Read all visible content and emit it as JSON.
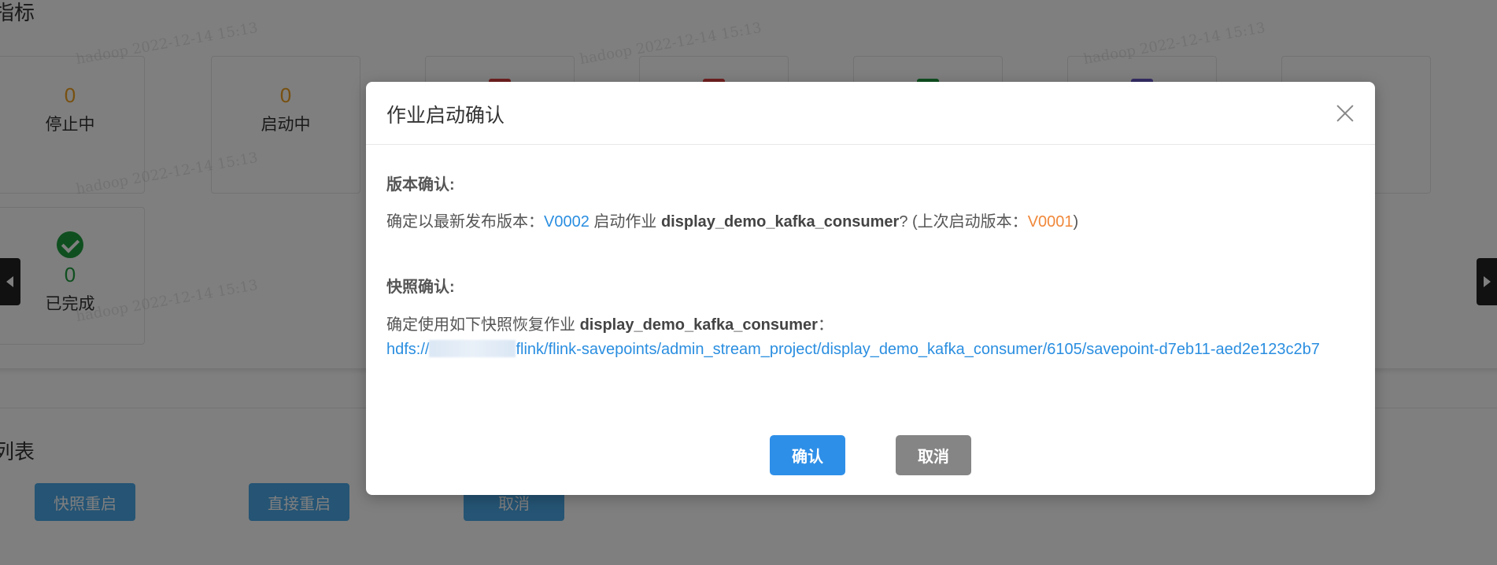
{
  "background": {
    "metrics_title": "指标",
    "list_title": "列表",
    "watermark_text": "hadoop  2022-12-14  15:13",
    "stat_cards": [
      {
        "value": "0",
        "label": "停止中",
        "color": "#f0a020"
      },
      {
        "value": "0",
        "label": "启动中",
        "color": "#f0a020"
      },
      {
        "value": "0",
        "label": "已完成",
        "color": "#1e9e3e"
      }
    ],
    "buttons": [
      {
        "label": "快照重启"
      },
      {
        "label": "直接重启"
      },
      {
        "label": "取消"
      }
    ]
  },
  "dialog": {
    "title": "作业启动确认",
    "version_section": {
      "heading": "版本确认:",
      "prefix": "确定以最新发布版本：",
      "new_version": "V0002",
      "mid": " 启动作业 ",
      "job_name": "display_demo_kafka_consumer",
      "suffix_open": "? (上次启动版本：",
      "last_version": "V0001",
      "suffix_close": ")"
    },
    "snapshot_section": {
      "heading": "快照确认:",
      "prefix": "确定使用如下快照恢复作业 ",
      "job_name": "display_demo_kafka_consumer",
      "colon": "：",
      "path_start": "hdfs://",
      "path_rest": "flink/flink-savepoints/admin_stream_project/display_demo_kafka_consumer/6105/savepoint-d7eb11-aed2e123c2b7"
    },
    "confirm_label": "确认",
    "cancel_label": "取消"
  },
  "colors": {
    "primary": "#2e8fe8",
    "link": "#2a8ee0",
    "warning": "#f0883a",
    "secondary": "#858585"
  }
}
